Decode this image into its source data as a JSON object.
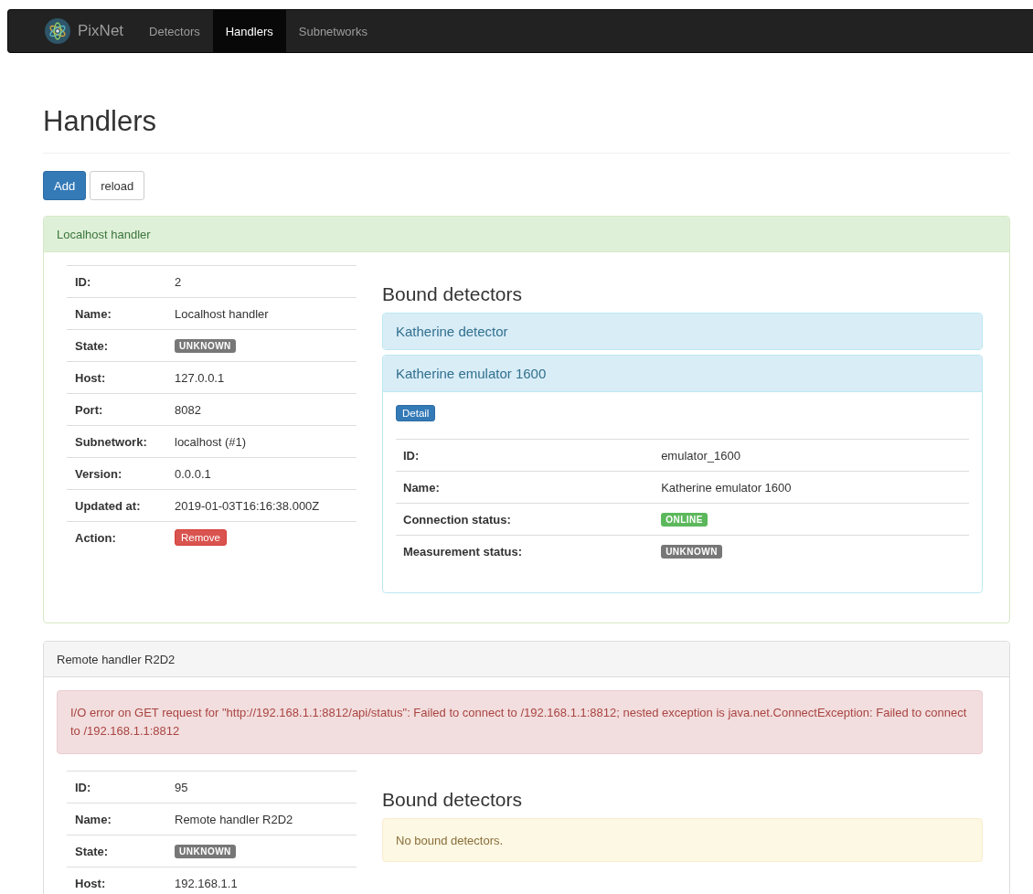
{
  "navbar": {
    "brand": "PixNet",
    "items": [
      {
        "label": "Detectors",
        "selected": false
      },
      {
        "label": "Handlers",
        "selected": true
      },
      {
        "label": "Subnetworks",
        "selected": false
      }
    ]
  },
  "page_title": "Handlers",
  "toolbar": [
    {
      "label": "Add",
      "kind": "primary"
    },
    {
      "label": "reload",
      "kind": "default"
    }
  ],
  "handlers": [
    {
      "title": "Localhost handler",
      "kind": "success",
      "details": [
        {
          "label": "ID:",
          "value": "2",
          "kind": "text"
        },
        {
          "label": "Name:",
          "value": "Localhost handler",
          "kind": "text"
        },
        {
          "label": "State:",
          "value": "UNKNOWN",
          "kind": "badge",
          "color": "#777777"
        },
        {
          "label": "Host:",
          "value": "127.0.0.1",
          "kind": "text"
        },
        {
          "label": "Port:",
          "value": "8082",
          "kind": "text"
        },
        {
          "label": "Subnetwork:",
          "value": "localhost (#1)",
          "kind": "text"
        },
        {
          "label": "Version:",
          "value": "0.0.0.1",
          "kind": "text"
        },
        {
          "label": "Updated at:",
          "value": "2019-01-03T16:16:38.000Z",
          "kind": "text"
        },
        {
          "label": "Action:",
          "value": "Remove",
          "kind": "button"
        }
      ],
      "bound_title": "Bound detectors",
      "detectors": [
        {
          "name": "Katherine detector",
          "expanded": false
        },
        {
          "name": "Katherine emulator 1600",
          "expanded": true,
          "button": "Detail",
          "details": [
            {
              "label": "ID:",
              "value": "emulator_1600",
              "kind": "text"
            },
            {
              "label": "Name:",
              "value": "Katherine emulator 1600",
              "kind": "text"
            },
            {
              "label": "Connection status:",
              "value": "ONLINE",
              "kind": "badge",
              "color": "#5cb85c"
            },
            {
              "label": "Measurement status:",
              "value": "UNKNOWN",
              "kind": "badge",
              "color": "#777777"
            }
          ]
        }
      ]
    },
    {
      "title": "Remote handler R2D2",
      "kind": "default",
      "error": "I/O error on GET request for \"http://192.168.1.1:8812/api/status\": Failed to connect to /192.168.1.1:8812; nested exception is java.net.ConnectException: Failed to connect to /192.168.1.1:8812",
      "details": [
        {
          "label": "ID:",
          "value": "95",
          "kind": "text"
        },
        {
          "label": "Name:",
          "value": "Remote handler R2D2",
          "kind": "text"
        },
        {
          "label": "State:",
          "value": "UNKNOWN",
          "kind": "badge",
          "color": "#777777"
        },
        {
          "label": "Host:",
          "value": "192.168.1.1",
          "kind": "text"
        }
      ],
      "bound_title": "Bound detectors",
      "empty_message": "No bound detectors."
    }
  ]
}
